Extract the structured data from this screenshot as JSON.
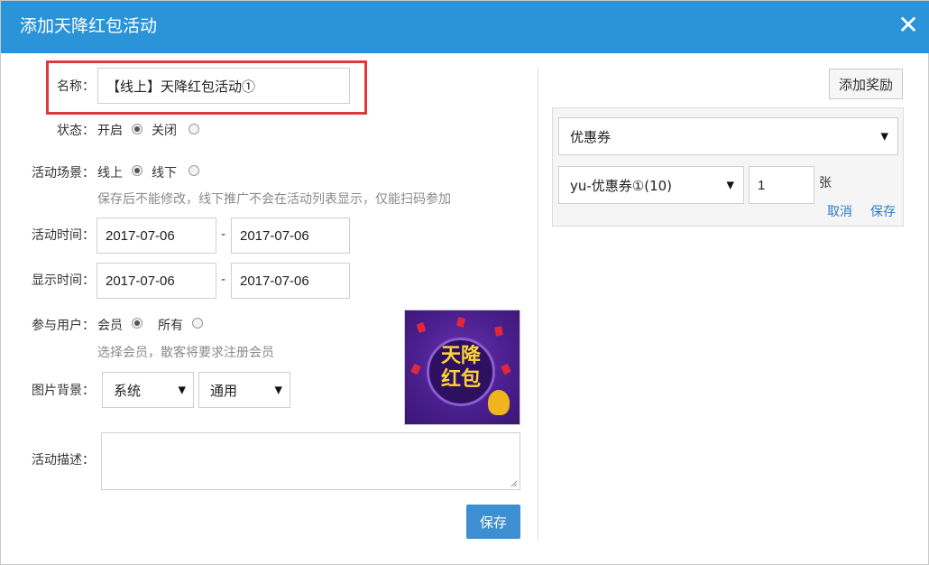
{
  "dialog": {
    "title": "添加天降红包活动",
    "close_glyph": "✕"
  },
  "form": {
    "name_label": "名称：",
    "name_value": "【线上】天降红包活动①",
    "status_label": "状态：",
    "status_on": "开启",
    "status_off": "关闭",
    "scene_label": "活动场景：",
    "scene_online": "线上",
    "scene_offline": "线下",
    "scene_hint": "保存后不能修改，线下推广不会在活动列表显示，仅能扫码参加",
    "time_label": "活动时间：",
    "time_start": "2017-07-06",
    "time_end": "2017-07-06",
    "display_label": "显示时间：",
    "display_start": "2017-07-06",
    "display_end": "2017-07-06",
    "range_sep": "-",
    "users_label": "参与用户：",
    "users_member": "会员",
    "users_all": "所有",
    "users_hint": "选择会员，散客将要求注册会员",
    "bg_label": "图片背景：",
    "bg_select_1": "系统",
    "bg_select_2": "通用",
    "desc_label": "活动描述：",
    "save_button": "保存"
  },
  "poster": {
    "text_line1": "天降",
    "text_line2": "红包"
  },
  "reward": {
    "add_button": "添加奖励",
    "type_select": "优惠券",
    "coupon_select": "yu-优惠券①(10)",
    "quantity": "1",
    "unit": "张",
    "cancel_link": "取消",
    "save_link": "保存"
  },
  "icons": {
    "select_arrow": "▼"
  },
  "colors": {
    "header": "#2b93d8",
    "highlight_box": "#e0393d",
    "primary_button": "#3d8fd1",
    "link": "#2b7ac9"
  }
}
